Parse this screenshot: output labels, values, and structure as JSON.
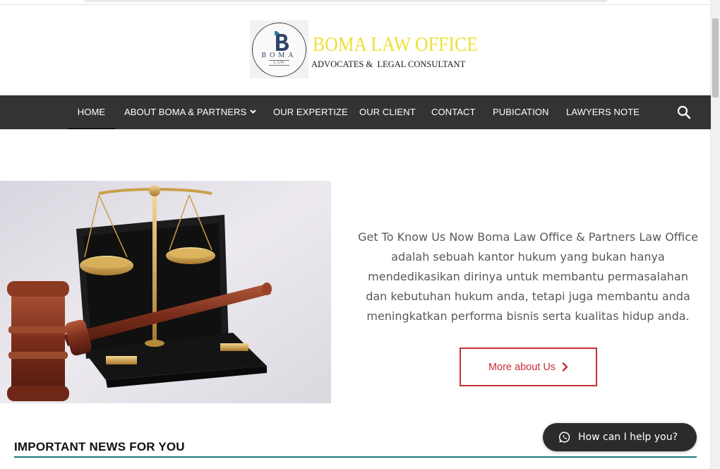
{
  "header": {
    "logo_word": "BOMA",
    "logo_sub": "LAW",
    "brand_title": "BOMA LAW OFFICE",
    "brand_subtitle": "ADVOCATES &  LEGAL CONSULTANT"
  },
  "nav": {
    "items": [
      {
        "label": "HOME",
        "active": true
      },
      {
        "label": "ABOUT BOMA & PARTNERS",
        "has_dropdown": true
      },
      {
        "label": "OUR EXPERTIZE"
      },
      {
        "label": "OUR CLIENT"
      },
      {
        "label": "CONTACT"
      },
      {
        "label": "PUBICATION"
      },
      {
        "label": "LAWYERS NOTE"
      }
    ],
    "search_icon": "search-icon"
  },
  "about": {
    "text": "Get To Know Us Now Boma Law Office & Partners Law Office adalah sebuah kantor hukum yang bukan hanya mendedikasikan dirinya untuk membantu permasalahan dan kebutuhan hukum anda, tetapi juga membantu anda meningkatkan performa bisnis serta kualitas hidup anda.",
    "button_label": "More about Us",
    "button_icon": "chevron-right-icon"
  },
  "news": {
    "title": "IMPORTANT NEWS FOR YOU"
  },
  "chat": {
    "label": "How can I help you?",
    "icon": "whatsapp-icon"
  },
  "colors": {
    "accent_red": "#c72e37",
    "nav_bg": "#333333",
    "brand_yellow": "#ede038",
    "news_underline": "#1f7b7b"
  }
}
